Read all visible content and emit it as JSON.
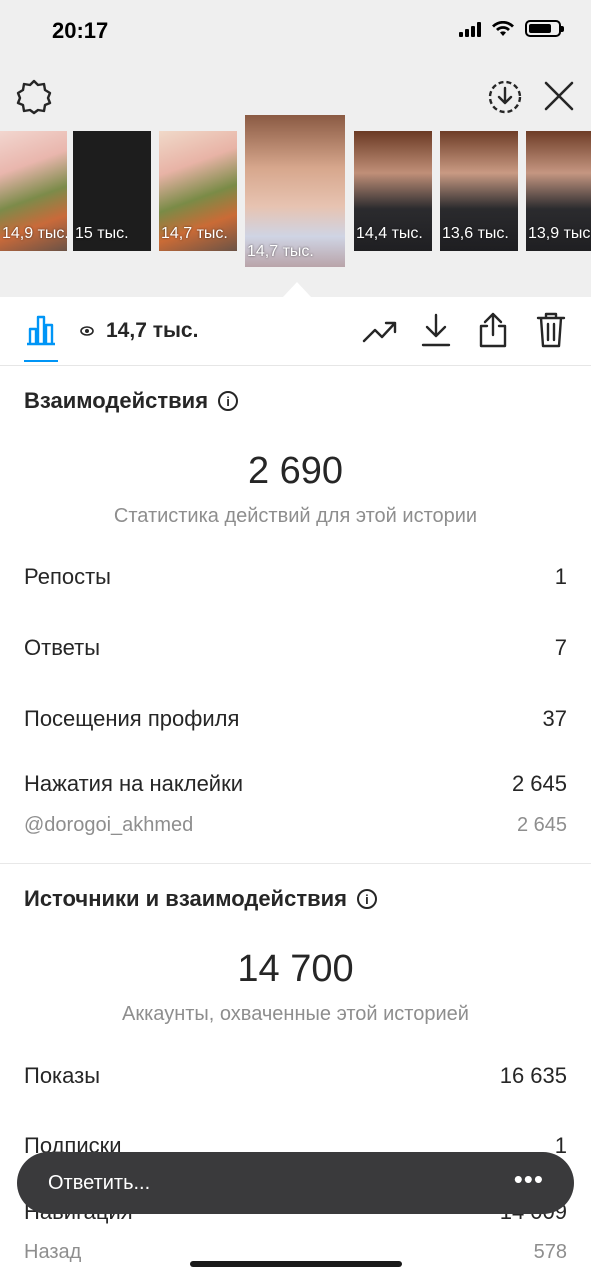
{
  "status_bar": {
    "time": "20:17"
  },
  "stories": [
    {
      "views": "14,9 тыс."
    },
    {
      "views": "15 тыс."
    },
    {
      "views": "14,7 тыс."
    },
    {
      "views": "14,7 тыс.",
      "selected": true
    },
    {
      "views": "14,4 тыс."
    },
    {
      "views": "13,6 тыс."
    },
    {
      "views": "13,9 тыс."
    }
  ],
  "toolbar": {
    "views": "14,7 тыс."
  },
  "interactions": {
    "title": "Взаимодействия",
    "total": "2 690",
    "subtitle": "Статистика действий для этой истории",
    "rows": [
      {
        "label": "Репосты",
        "value": "1"
      },
      {
        "label": "Ответы",
        "value": "7"
      },
      {
        "label": "Посещения профиля",
        "value": "37"
      },
      {
        "label": "Нажатия на наклейки",
        "value": "2 645"
      }
    ],
    "sticker": {
      "label": "@dorogoi_akhmed",
      "value": "2 645"
    }
  },
  "discovery": {
    "title": "Источники и взаимодействия",
    "total": "14 700",
    "subtitle": "Аккаунты, охваченные этой историей",
    "rows": [
      {
        "label": "Показы",
        "value": "16 635"
      },
      {
        "label": "Подписки",
        "value": "1"
      },
      {
        "label": "Навигация",
        "value": "14 009"
      }
    ],
    "sub_rows": [
      {
        "label": "Назад",
        "value": "578"
      }
    ]
  },
  "reply": {
    "placeholder": "Ответить...",
    "more": "•••"
  }
}
